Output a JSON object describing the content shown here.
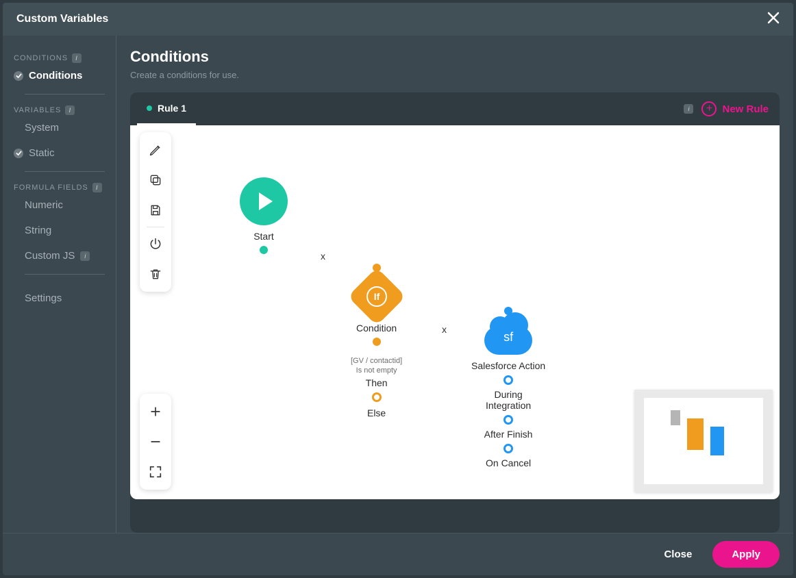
{
  "modal": {
    "title": "Custom Variables"
  },
  "sidebar": {
    "sections": {
      "conditions": {
        "title": "CONDITIONS",
        "items": [
          {
            "label": "Conditions",
            "checked": true,
            "active": true
          }
        ]
      },
      "variables": {
        "title": "VARIABLES",
        "items": [
          {
            "label": "System"
          },
          {
            "label": "Static",
            "checked": true
          }
        ]
      },
      "formula": {
        "title": "FORMULA FIELDS",
        "items": [
          {
            "label": "Numeric"
          },
          {
            "label": "String"
          },
          {
            "label": "Custom JS",
            "info": true
          }
        ]
      },
      "other": {
        "items": [
          {
            "label": "Settings"
          }
        ]
      }
    }
  },
  "page": {
    "title": "Conditions",
    "subtitle": "Create a conditions for use."
  },
  "tabs": {
    "rule1": "Rule 1",
    "newRule": "New Rule"
  },
  "canvas": {
    "start": {
      "label": "Start"
    },
    "condition": {
      "label": "Condition",
      "ifText": "If",
      "expr1": "[GV / contactid]",
      "expr2": "Is not empty",
      "then": "Then",
      "else": "Else"
    },
    "sf": {
      "label": "Salesforce Action",
      "logo": "sf",
      "during": "During\nIntegration",
      "after": "After Finish",
      "cancel": "On Cancel"
    },
    "edgeX": "x"
  },
  "footer": {
    "close": "Close",
    "apply": "Apply"
  }
}
